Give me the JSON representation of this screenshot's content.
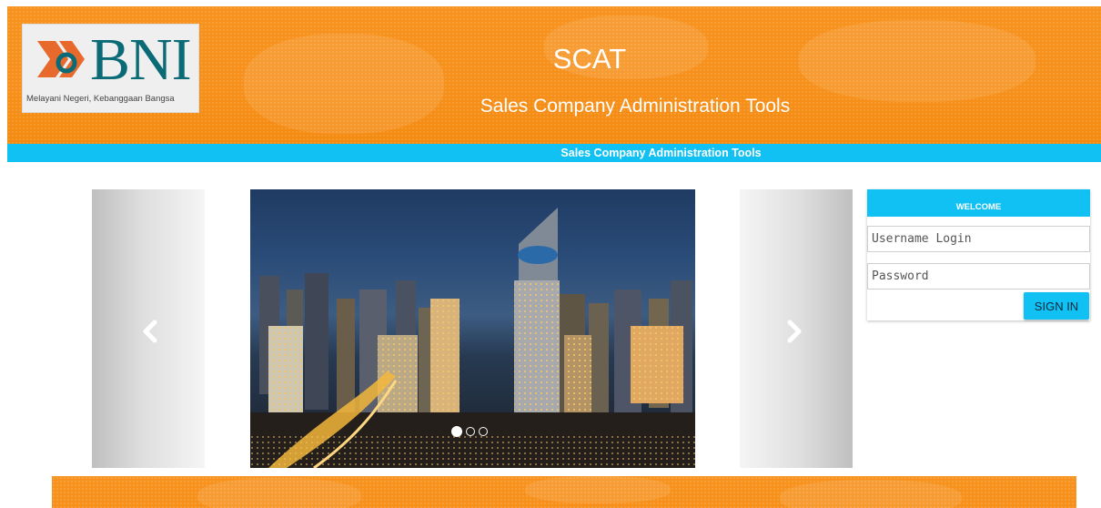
{
  "header": {
    "logo_text": "BNI",
    "logo_tagline": "Melayani Negeri, Kebanggaan Bangsa",
    "title": "SCAT",
    "subtitle": "Sales Company Administration Tools",
    "brand_color": "#f7921e",
    "logo_color": "#0a6a75"
  },
  "subbar": {
    "text": "Sales Company Administration Tools",
    "color": "#11c1f3"
  },
  "carousel": {
    "prev_icon": "chevron-left-icon",
    "next_icon": "chevron-right-icon",
    "slide_count": 3,
    "active_index": 0
  },
  "login": {
    "heading": "WELCOME",
    "username_placeholder": "Username Login",
    "password_placeholder": "Password",
    "submit_label": "SIGN IN",
    "accent_color": "#11c1f3"
  }
}
